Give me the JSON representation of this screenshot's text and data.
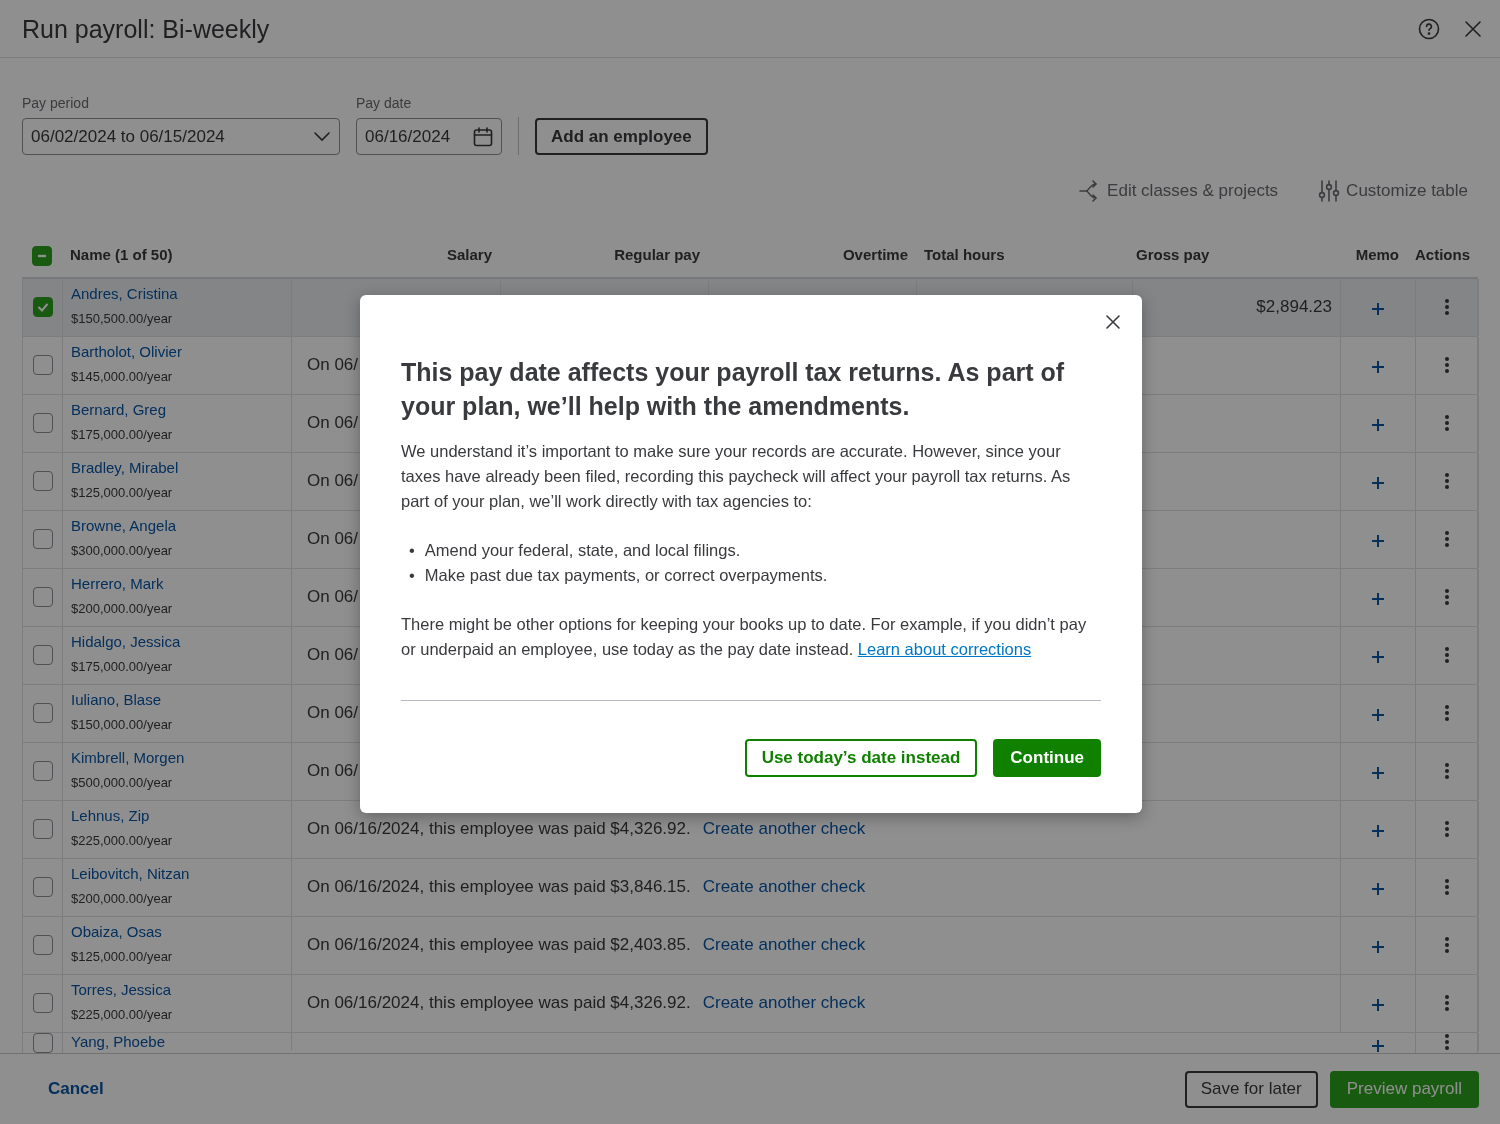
{
  "window": {
    "title": "Run payroll: Bi-weekly"
  },
  "pay_period": {
    "label": "Pay period",
    "value": "06/02/2024 to 06/15/2024"
  },
  "pay_date": {
    "label": "Pay date",
    "value": "06/16/2024"
  },
  "add_employee": "Add an employee",
  "toolbar": {
    "edit_classes": "Edit classes & projects",
    "customize_table": "Customize table"
  },
  "table": {
    "select_all_indeterminate": true,
    "columns": [
      "Name (1 of 50)",
      "Salary",
      "Regular pay",
      "Overtime",
      "Total hours",
      "Gross pay",
      "Memo",
      "Actions"
    ],
    "rows": [
      {
        "kind": "pending",
        "name": "Andres, Cristina",
        "salary": "$150,500.00/year",
        "checked": true,
        "gross_pay": "$2,894.23"
      },
      {
        "kind": "paid",
        "name": "Bartholot, Olivier",
        "salary": "$145,000.00/year",
        "checked": false,
        "message": "On 06/"
      },
      {
        "kind": "paid",
        "name": "Bernard, Greg",
        "salary": "$175,000.00/year",
        "checked": false,
        "message": "On 06/"
      },
      {
        "kind": "paid",
        "name": "Bradley, Mirabel",
        "salary": "$125,000.00/year",
        "checked": false,
        "message": "On 06/"
      },
      {
        "kind": "paid",
        "name": "Browne, Angela",
        "salary": "$300,000.00/year",
        "checked": false,
        "message": "On 06/"
      },
      {
        "kind": "paid",
        "name": "Herrero, Mark",
        "salary": "$200,000.00/year",
        "checked": false,
        "message": "On 06/"
      },
      {
        "kind": "paid",
        "name": "Hidalgo, Jessica",
        "salary": "$175,000.00/year",
        "checked": false,
        "message": "On 06/"
      },
      {
        "kind": "paid",
        "name": "Iuliano, Blase",
        "salary": "$150,000.00/year",
        "checked": false,
        "message": "On 06/"
      },
      {
        "kind": "paid",
        "name": "Kimbrell, Morgen",
        "salary": "$500,000.00/year",
        "checked": false,
        "message": "On 06/"
      },
      {
        "kind": "paid",
        "name": "Lehnus, Zip",
        "salary": "$225,000.00/year",
        "checked": false,
        "message": "On 06/16/2024, this employee was paid $4,326.92.",
        "link": "Create another check"
      },
      {
        "kind": "paid",
        "name": "Leibovitch, Nitzan",
        "salary": "$200,000.00/year",
        "checked": false,
        "message": "On 06/16/2024, this employee was paid $3,846.15.",
        "link": "Create another check"
      },
      {
        "kind": "paid",
        "name": "Obaiza, Osas",
        "salary": "$125,000.00/year",
        "checked": false,
        "message": "On 06/16/2024, this employee was paid $2,403.85.",
        "link": "Create another check"
      },
      {
        "kind": "paid",
        "name": "Torres, Jessica",
        "salary": "$225,000.00/year",
        "checked": false,
        "message": "On 06/16/2024, this employee was paid $4,326.92.",
        "link": "Create another check"
      },
      {
        "kind": "cut",
        "name": "Yang, Phoebe",
        "checked": false
      }
    ]
  },
  "footer": {
    "cancel": "Cancel",
    "save": "Save for later",
    "preview": "Preview payroll"
  },
  "dialog": {
    "title": "This pay date affects your payroll tax returns. As part of your plan, we’ll help with the amendments.",
    "intro": "We understand it’s important to make sure your records are accurate. However, since your taxes have already been filed, recording this paycheck will affect your payroll tax returns. As part of your plan, we’ll work directly with tax agencies to:",
    "bullet_marker": "•",
    "bullets": [
      "Amend your federal, state, and local filings.",
      "Make past due tax payments, or correct overpayments."
    ],
    "note": "There might be other options for keeping your books up to date. For example, if you didn’t pay or underpaid an employee, use today as the pay date instead.",
    "note_link": "Learn about corrections",
    "secondary_button": "Use today’s date instead",
    "primary_button": "Continue"
  }
}
